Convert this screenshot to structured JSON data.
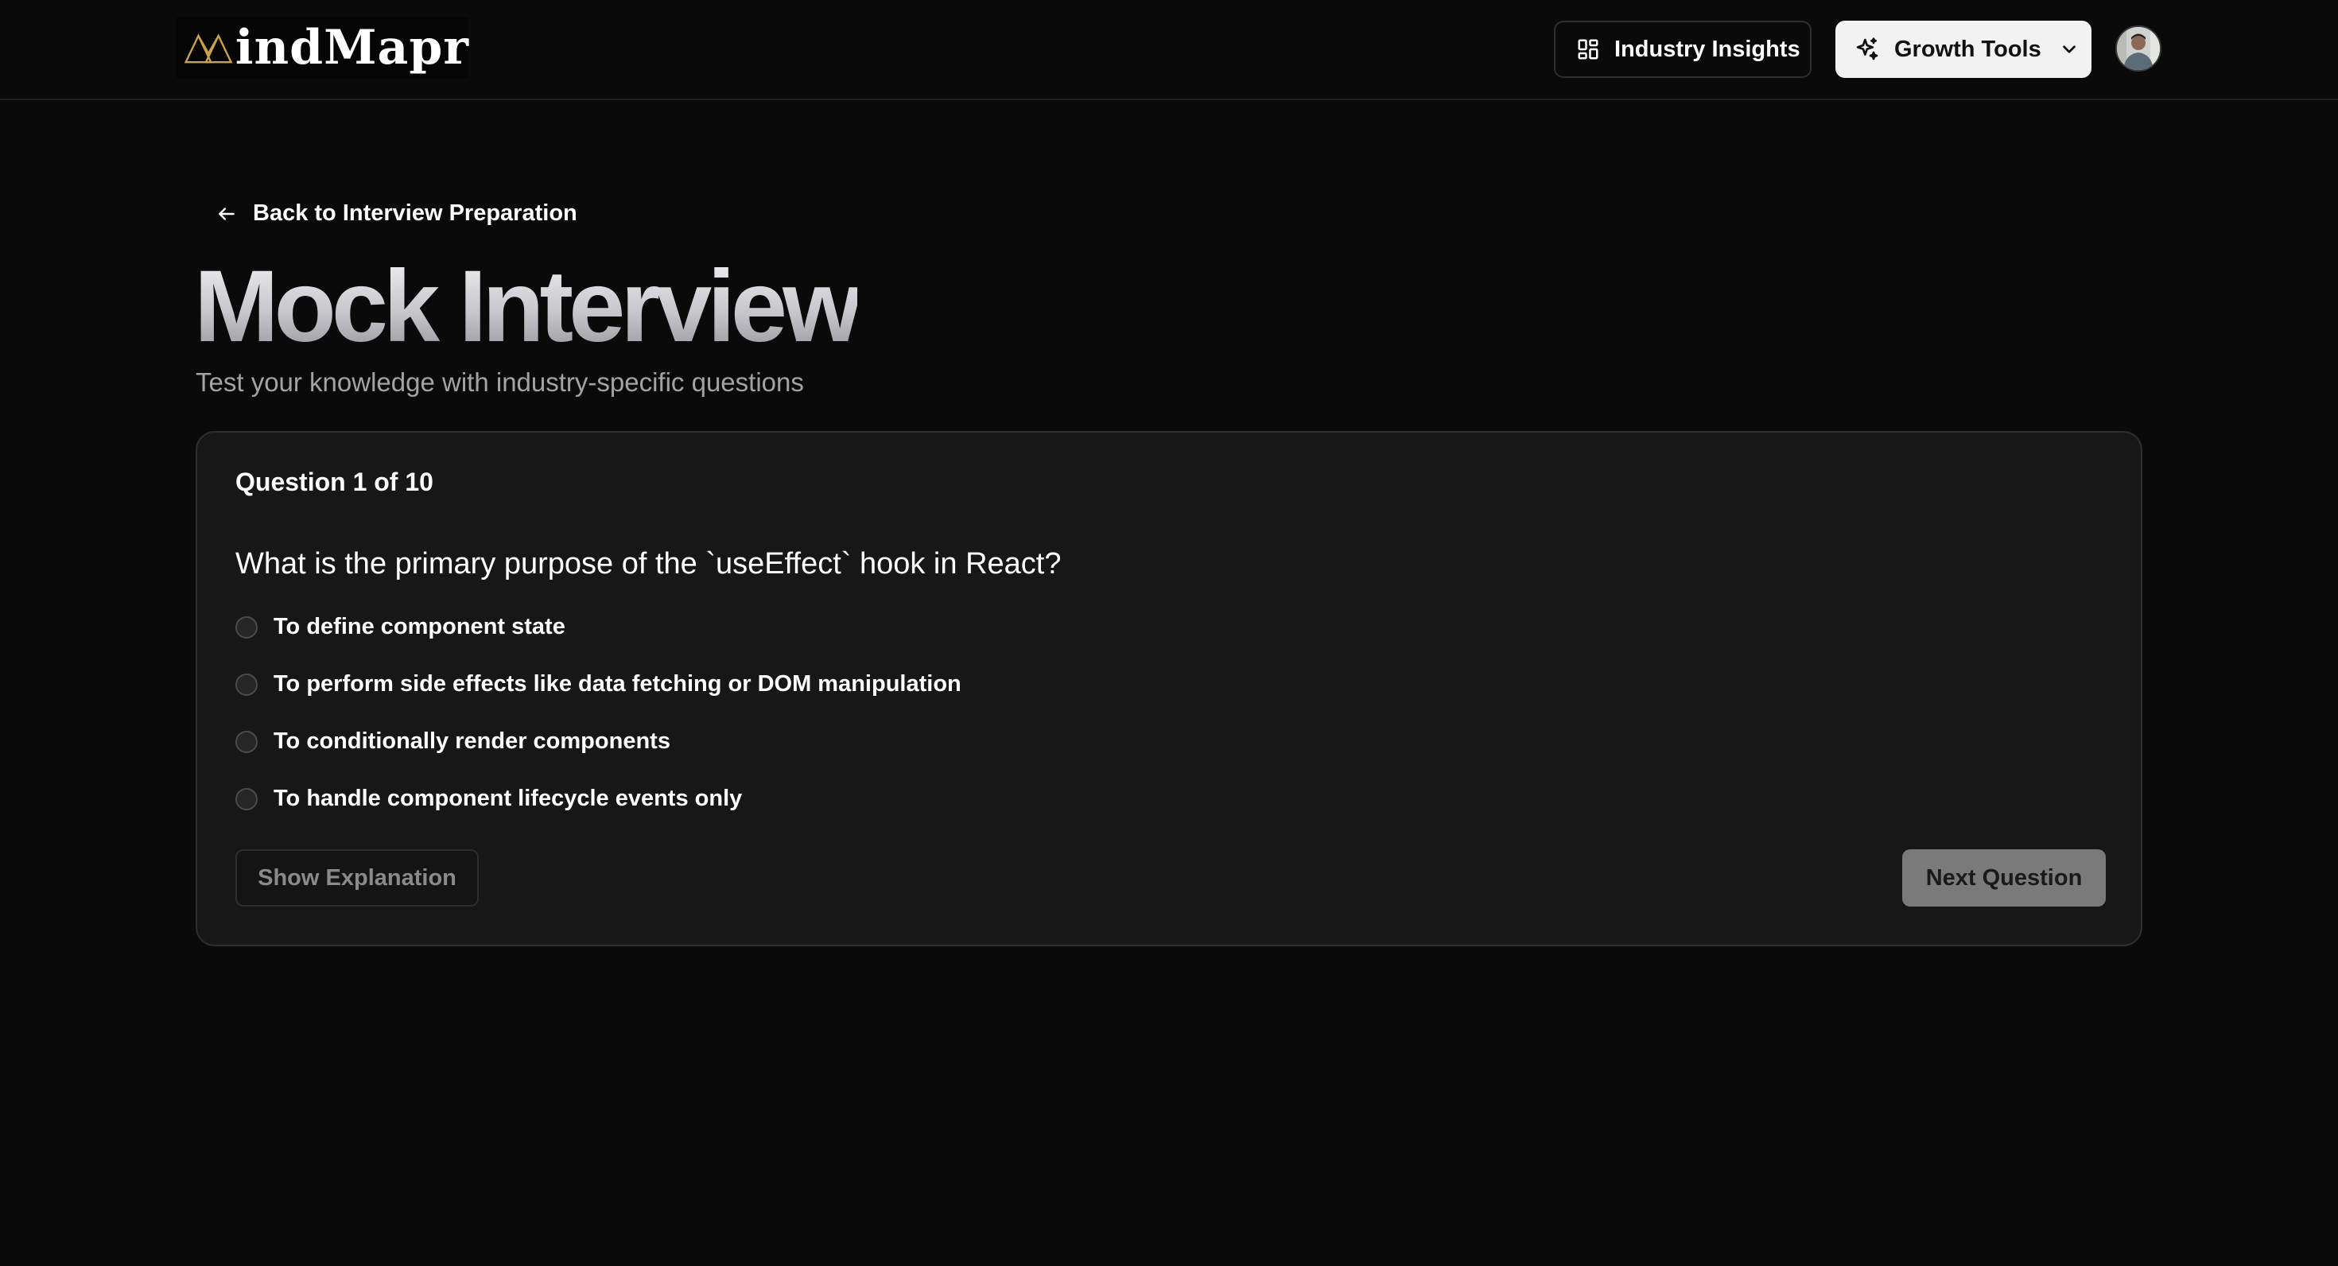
{
  "header": {
    "logo_text": "indMapr",
    "nav": {
      "insights_label": "Industry Insights",
      "growth_label": "Growth Tools"
    }
  },
  "main": {
    "back_label": "Back to Interview Preparation",
    "title": "Mock Interview",
    "subtitle": "Test your knowledge with industry-specific questions"
  },
  "quiz": {
    "counter": "Question 1 of 10",
    "question": "What is the primary purpose of the `useEffect` hook in React?",
    "options": [
      "To define component state",
      "To perform side effects like data fetching or DOM manipulation",
      "To conditionally render components",
      "To handle component lifecycle events only"
    ],
    "explain_label": "Show Explanation",
    "next_label": "Next Question"
  },
  "colors": {
    "background": "#0a0a0a",
    "card": "#171717",
    "border": "#2e2e2e",
    "logo_accent": "#c9a24a",
    "next_button": "#7a7a7a"
  },
  "icons": {
    "logo_mark": "triangle-m-icon",
    "insights": "grid-icon",
    "growth": "sparkles-icon",
    "growth_menu": "chevron-down-icon",
    "back": "arrow-left-icon"
  }
}
